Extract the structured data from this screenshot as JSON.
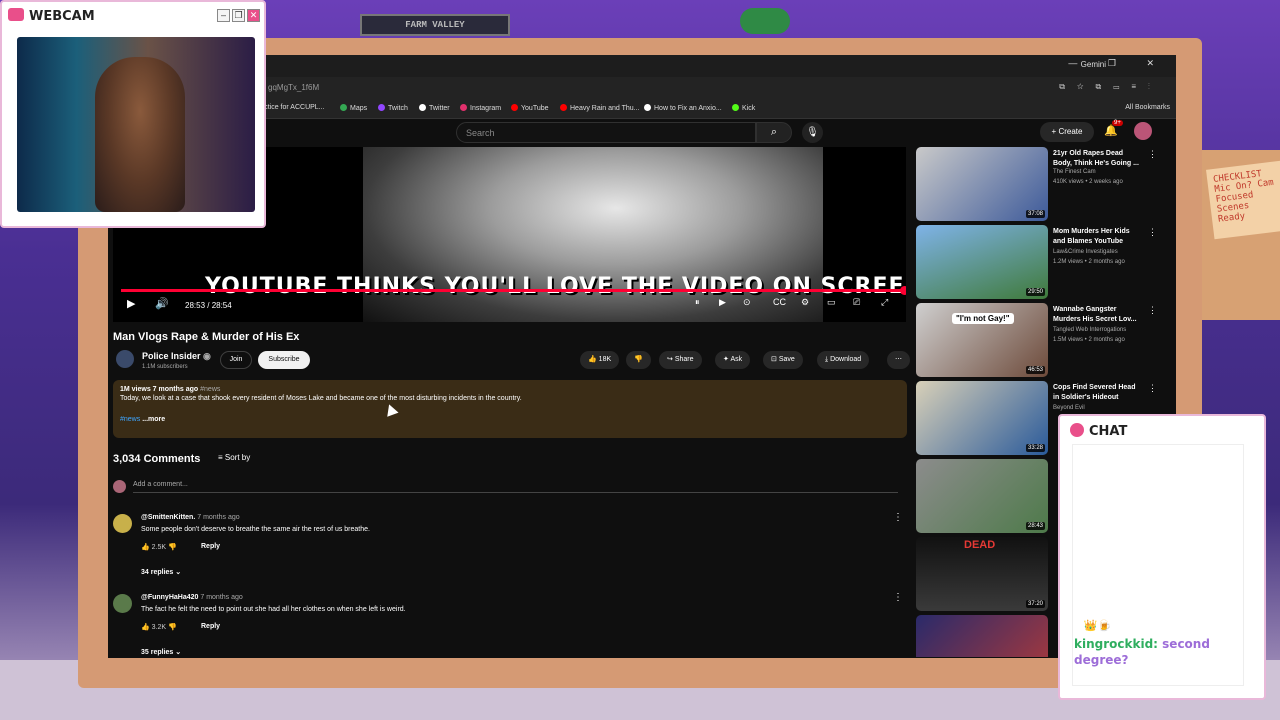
{
  "webcam": {
    "title": "WEBCAM"
  },
  "browser": {
    "gemini": "Gemini",
    "url": "gqMgTx_1f6M",
    "bookmarks": [
      {
        "label": "ractice for ACCUPL...",
        "color": "#888888"
      },
      {
        "label": "Maps",
        "color": "#34a853"
      },
      {
        "label": "Twitch",
        "color": "#9146ff"
      },
      {
        "label": "Twitter",
        "color": "#ffffff"
      },
      {
        "label": "Instagram",
        "color": "#e1306c"
      },
      {
        "label": "YouTube",
        "color": "#ff0000"
      },
      {
        "label": "Heavy Rain and Thu...",
        "color": "#ff0000"
      },
      {
        "label": "How to Fix an Anxio...",
        "color": "#ffffff"
      },
      {
        "label": "Kick",
        "color": "#53fc18"
      }
    ],
    "all_bookmarks": "All Bookmarks"
  },
  "yt": {
    "search_placeholder": "Search",
    "create": "Create",
    "notif_badge": "9+"
  },
  "player": {
    "overlay_text": "YOUTUBE THINKS YOU'LL LOVE THE VIDEO ON SCREEN.",
    "time": "28:53 / 28:54",
    "progress_pct": 99.9
  },
  "video": {
    "title": "Man Vlogs Rape & Murder of His Ex",
    "channel": "Police Insider",
    "subscribers": "1.1M subscribers",
    "join": "Join",
    "subscribe": "Subscribe",
    "likes": "18K",
    "share": "Share",
    "ask": "Ask",
    "save": "Save",
    "download": "Download",
    "views_age": "1M views  7 months ago",
    "hashtag": "#news",
    "description": "Today, we look at a case that shook every resident of Moses Lake and became one of the most disturbing incidents in the country.",
    "desc_tag": "#news",
    "more": "...more"
  },
  "comments": {
    "count": "3,034 Comments",
    "sort_by": "Sort by",
    "add": "Add a comment...",
    "items": [
      {
        "user": "@SmittenKitten.",
        "age": "7 months ago",
        "text": "Some people don't deserve to breathe the same air the rest of us breathe.",
        "likes": "2.5K",
        "reply": "Reply",
        "replies": "34 replies"
      },
      {
        "user": "@FunnyHaHa420",
        "age": "7 months ago",
        "text": "The fact he felt the need to point out she had all her clothes on when she left is weird.",
        "likes": "3.2K",
        "reply": "Reply",
        "replies": "35 replies"
      }
    ]
  },
  "recommendations": [
    {
      "title": "21yr Old Rapes Dead Body, Think He's Going ...",
      "channel": "The Finest Cam",
      "meta": "410K views • 2 weeks ago",
      "duration": "37:08"
    },
    {
      "title": "Mom Murders Her Kids and Blames YouTube",
      "channel": "Law&Crime Investigates",
      "meta": "1.2M views • 2 months ago",
      "duration": "29:50"
    },
    {
      "title": "Wannabe Gangster Murders His Secret Lov...",
      "channel": "Tangled Web Interrogations",
      "meta": "1.5M views • 2 months ago",
      "duration": "46:53",
      "thumb_text": "\"I'm not Gay!\""
    },
    {
      "title": "Cops Find Severed Head in Soldier's Hideout",
      "channel": "Beyond Evil",
      "meta": "",
      "duration": "33:28"
    },
    {
      "title": "",
      "channel": "",
      "meta": "",
      "duration": "28:43"
    },
    {
      "title": "",
      "channel": "",
      "meta": "",
      "duration": "37:20",
      "thumb_text": "DEAD"
    },
    {
      "title": "",
      "channel": "",
      "meta": "",
      "duration": ""
    }
  ],
  "chat": {
    "title": "CHAT",
    "user": "kingrockkid:",
    "message": "second degree?"
  },
  "sticky": {
    "text": "CHECKLIST Mic On? Cam Focused Scenes Ready"
  },
  "poster": {
    "text": "FARM VALLEY"
  }
}
